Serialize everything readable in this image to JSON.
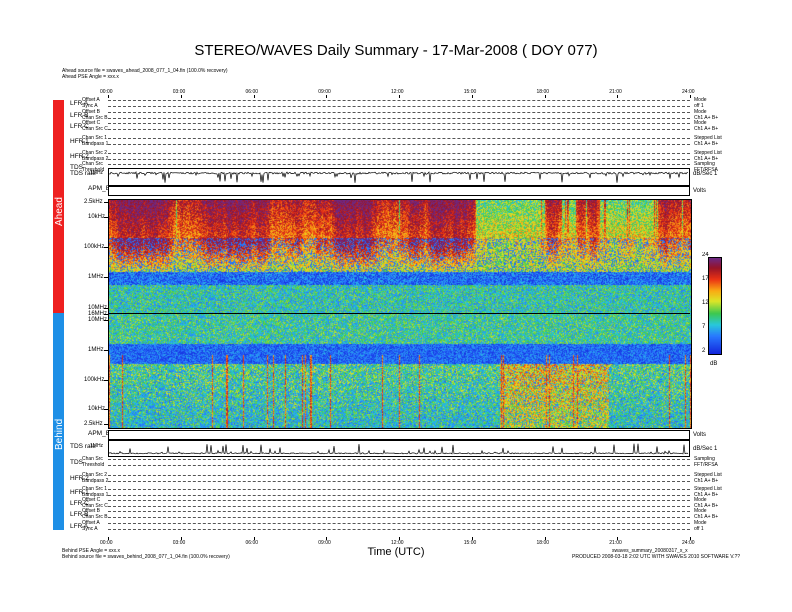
{
  "header": {
    "title": "STEREO/WAVES Daily Summary - 17-Mar-2008 ( DOY 077)",
    "ahead_source": "Ahead source file = swaves_ahead_2008_077_1_04.fin (100.0% recovery)",
    "ahead_angle": "Ahead PSE Angle = xxx.x"
  },
  "footer": {
    "behind_angle": "Behind PSE Angle = xxx.x",
    "behind_source": "Behind source file = swaves_behind_2008_077_1_04.fin (100.0% recovery)",
    "xlabel": "Time (UTC)",
    "product_name": "swaves_summary_20080317_x_x",
    "product_info": "PRODUCED 2008-03-18 2:02 UTC WITH SWAVES 2010 SOFTWARE V.??"
  },
  "spacecraft": {
    "ahead": "Ahead",
    "behind": "Behind",
    "ahead_color": "#ee2020",
    "behind_color": "#1e8fe6"
  },
  "ahead_rows": [
    {
      "label": "LFR A",
      "sub1": "Offset A",
      "sub2": "Sync A",
      "right1": "Mode",
      "right2": "off 1"
    },
    {
      "label": "LFR B",
      "sub1": "Offset B",
      "sub2": "Chan Src B",
      "right1": "Mode",
      "right2": "Ch1 A+ B+"
    },
    {
      "label": "LFR C",
      "sub1": "Offset C",
      "sub2": "Chan Src C",
      "right1": "Mode",
      "right2": "Ch1 A+ B+"
    },
    {
      "label": "HFR 1",
      "sub1": "Chan Src 1",
      "sub2": "Bandpass 1",
      "right1": "Stepped List",
      "right2": "Ch1 A+ B+"
    },
    {
      "label": "HFR 2",
      "sub1": "Chan Src 2",
      "sub2": "Bandpass 2",
      "right1": "Stepped List",
      "right2": "Ch1 A+ B+"
    },
    {
      "label": "TDS",
      "sub1": "Chan Src",
      "sub2": "Threshold",
      "right1": "Sampling",
      "right2": "FFT/RFSA"
    }
  ],
  "behind_rows": [
    {
      "label": "TDS",
      "sub1": "Chan Src",
      "sub2": "Threshold",
      "right1": "Sampling",
      "right2": "FFT/RFSA"
    },
    {
      "label": "HFR 2",
      "sub1": "Chan Src 2",
      "sub2": "Bandpass 2",
      "right1": "Stepped List",
      "right2": "Ch1 A+ B+"
    },
    {
      "label": "HFR 1",
      "sub1": "Chan Src 1",
      "sub2": "Bandpass 1",
      "right1": "Stepped List",
      "right2": "Ch1 A+ B+"
    },
    {
      "label": "LFR C",
      "sub1": "Offset C",
      "sub2": "Chan Src C",
      "right1": "Mode",
      "right2": "Ch1 A+ B+"
    },
    {
      "label": "LFR B",
      "sub1": "Offset B",
      "sub2": "Chan Src B",
      "right1": "Mode",
      "right2": "Ch1 A+ B+"
    },
    {
      "label": "LFR A",
      "sub1": "Offset A",
      "sub2": "Sync A",
      "right1": "Mode",
      "right2": "off 1"
    }
  ],
  "tds_rate": {
    "label": "TDS rate",
    "scale": "1MHz",
    "right": "dB/Sec 1"
  },
  "apm": {
    "label": "APM_BV",
    "right": "Volts"
  },
  "x_ticks": [
    "00:00",
    "03:00",
    "06:00",
    "09:00",
    "12:00",
    "15:00",
    "18:00",
    "21:00",
    "24:00"
  ],
  "ahead_freq_ticks": [
    "2.5kHz",
    "10kHz",
    "100kHz",
    "1MHz",
    "10MHz",
    "16MHz"
  ],
  "behind_freq_ticks": [
    "10MHz",
    "1MHz",
    "100kHz",
    "10kHz",
    "2.5kHz"
  ],
  "colorbar": {
    "ticks": [
      "24",
      "17",
      "12",
      "7",
      "2"
    ],
    "unit": "dB"
  },
  "chart_data": {
    "type": "heatmap",
    "title": "STEREO/WAVES Daily Summary - 17-Mar-2008 ( DOY 077)",
    "xlabel": "Time (UTC)",
    "x_range": [
      "2008-03-17T00:00",
      "2008-03-18T00:00"
    ],
    "y_scale": "log",
    "colorbar_range_db": [
      2,
      24
    ],
    "panels": [
      {
        "name": "Ahead",
        "y_range_hz": [
          2500,
          16000000
        ]
      },
      {
        "name": "Behind",
        "y_range_hz": [
          2500,
          16000000
        ]
      }
    ]
  }
}
